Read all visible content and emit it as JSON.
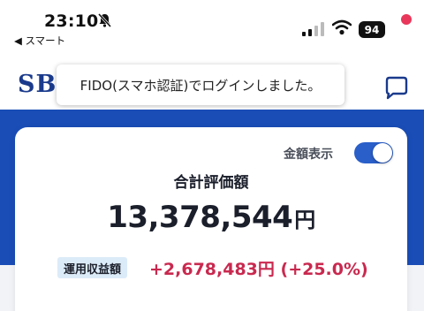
{
  "status_bar": {
    "time": "23:10",
    "back_label": "◀ スマート",
    "battery": "94",
    "icons": [
      "bell-slash-icon",
      "signal-icon",
      "wifi-icon",
      "battery-icon"
    ]
  },
  "header": {
    "logo": "SB",
    "toast": "FIDO(スマホ認証)でログインしました。",
    "chat_icon": "chat-bubble-icon"
  },
  "summary": {
    "toggle_label": "金額表示",
    "toggle_on": true,
    "total_label": "合計評価額",
    "total_value": "13,378,544",
    "total_unit": "円",
    "pl_label": "運用収益額",
    "pl_value": "+2,678,483円 (+25.0%)"
  },
  "colors": {
    "brand_blue": "#1a4db6",
    "logo_blue": "#1a3a8c",
    "profit_red": "#c9294f",
    "notification_dot": "#e8375a"
  }
}
